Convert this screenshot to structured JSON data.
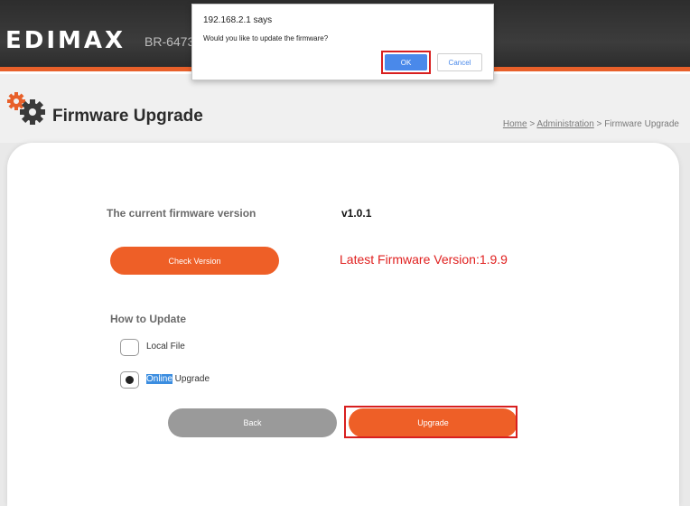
{
  "header": {
    "logo_text": "EDIMAX",
    "model": "BR-6473"
  },
  "page": {
    "title": "Firmware Upgrade",
    "breadcrumb": {
      "home": "Home",
      "sep1": " > ",
      "administration": "Administration",
      "sep2": " > ",
      "current": "Firmware Upgrade"
    }
  },
  "firmware": {
    "current_label": "The current firmware version",
    "current_version": "v1.0.1",
    "check_button": "Check Version",
    "latest_text": "Latest Firmware Version:1.9.9"
  },
  "how_to_update": {
    "label": "How to Update",
    "options": [
      {
        "label": "Local File",
        "selected": false
      },
      {
        "label_highlight": "Online",
        "label_rest": " Upgrade",
        "selected": true
      }
    ]
  },
  "actions": {
    "back": "Back",
    "upgrade": "Upgrade"
  },
  "dialog": {
    "title": "192.168.2.1 says",
    "message": "Would you like to update the firmware?",
    "ok": "OK",
    "cancel": "Cancel"
  },
  "colors": {
    "accent": "#ee5f27",
    "highlight_box": "#d81f1f",
    "latest_text": "#e0201f",
    "dialog_button": "#4a89ea"
  },
  "icons": [
    "gear-icon"
  ]
}
